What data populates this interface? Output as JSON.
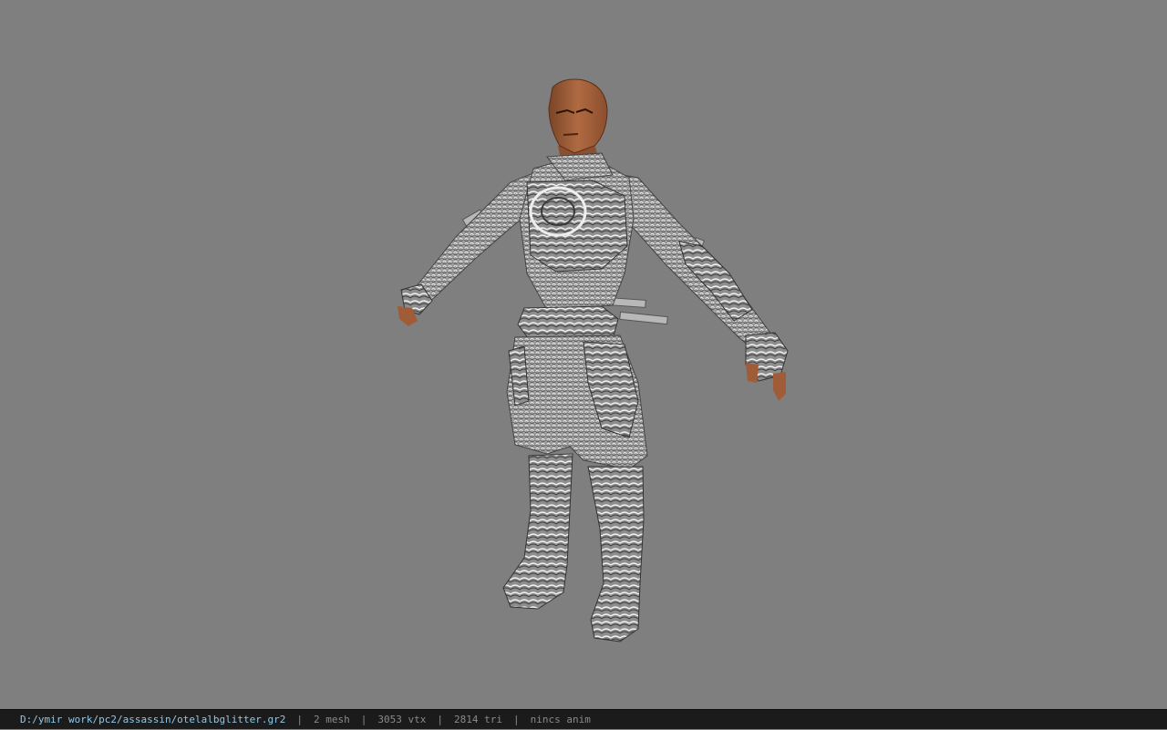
{
  "viewport": {
    "background_color": "#7f7f7f",
    "model_name": "assassin"
  },
  "status_bar": {
    "file_path": "D:/ymir work/pc2/assassin/otelalbglitter.gr2",
    "separator": "|",
    "mesh_count": "2 mesh",
    "vertex_count": "3053 vtx",
    "triangle_count": "2814 tri",
    "animation": "nincs anim",
    "path_color": "#8fc8e8",
    "text_color": "#8a8a8a",
    "background_color": "#1b1b1b"
  }
}
